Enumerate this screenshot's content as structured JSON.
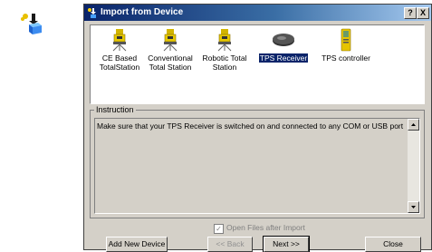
{
  "window": {
    "title": "Import from Device",
    "help_button": "?",
    "close_button": "X"
  },
  "devices": [
    {
      "label": "CE Based\nTotalStation",
      "selected": false
    },
    {
      "label": "Conventional\nTotal Station",
      "selected": false
    },
    {
      "label": "Robotic Total\nStation",
      "selected": false
    },
    {
      "label": "TPS Receiver",
      "selected": true
    },
    {
      "label": "TPS controller",
      "selected": false
    }
  ],
  "instruction": {
    "legend": "Instruction",
    "text": "Make sure that your TPS Receiver is switched on and connected to any COM or USB port"
  },
  "open_files": {
    "label": "Open Files after Import",
    "checked": true,
    "disabled": true
  },
  "buttons": {
    "add_new_device": "Add New Device",
    "back": "<< Back",
    "next": "Next >>",
    "close": "Close"
  },
  "colors": {
    "titlebar": "#0a246a",
    "dialog_bg": "#d4d0c8",
    "selection": "#0a246a"
  }
}
